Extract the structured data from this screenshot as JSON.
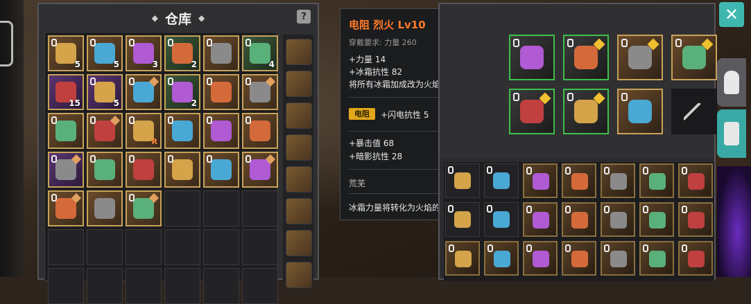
{
  "warehouse": {
    "title": "仓库",
    "help_label": "?",
    "slots": [
      [
        {
          "t": "gold",
          "c": "5",
          "lock": true
        },
        {
          "t": "gold",
          "c": "5",
          "lock": true
        },
        {
          "t": "gold",
          "c": "3",
          "lock": true
        },
        {
          "t": "green",
          "c": "2",
          "lock": true
        },
        {
          "t": "gold",
          "c": "",
          "lock": true
        },
        {
          "t": "green",
          "c": "4",
          "lock": true
        }
      ],
      [
        {
          "t": "purple",
          "c": "15",
          "lock": false
        },
        {
          "t": "purple",
          "c": "5",
          "lock": true
        },
        {
          "t": "gold",
          "c": "",
          "lock": true,
          "gem": true
        },
        {
          "t": "green",
          "c": "2",
          "lock": true
        },
        {
          "t": "gold",
          "c": "",
          "lock": true
        },
        {
          "t": "gold",
          "c": "",
          "lock": true,
          "gem": true
        }
      ],
      [
        {
          "t": "gold",
          "c": "",
          "lock": true
        },
        {
          "t": "gold",
          "c": "",
          "lock": true,
          "gem": true
        },
        {
          "t": "gold",
          "c": "",
          "lock": true,
          "r": "R"
        },
        {
          "t": "gold",
          "c": "",
          "lock": true
        },
        {
          "t": "gold",
          "c": "",
          "lock": true
        },
        {
          "t": "gold",
          "c": "",
          "lock": true
        }
      ],
      [
        {
          "t": "purple",
          "c": "",
          "lock": true,
          "gem": true
        },
        {
          "t": "gold",
          "c": "",
          "lock": true
        },
        {
          "t": "gold",
          "c": "",
          "lock": true
        },
        {
          "t": "gold",
          "c": "",
          "lock": true
        },
        {
          "t": "gold",
          "c": "",
          "lock": true
        },
        {
          "t": "gold",
          "c": "",
          "lock": true,
          "gem": true
        }
      ],
      [
        {
          "t": "gold",
          "c": "",
          "lock": true,
          "gem": true
        },
        {
          "t": "gold",
          "c": "",
          "lock": false
        },
        {
          "t": "gold",
          "c": "",
          "lock": true,
          "gem": true
        },
        {
          "t": "empty"
        },
        {
          "t": "empty"
        },
        {
          "t": "empty"
        }
      ],
      [
        {
          "t": "empty"
        },
        {
          "t": "empty"
        },
        {
          "t": "empty"
        },
        {
          "t": "empty"
        },
        {
          "t": "empty"
        },
        {
          "t": "empty"
        }
      ],
      [
        {
          "t": "empty"
        },
        {
          "t": "empty"
        },
        {
          "t": "empty"
        },
        {
          "t": "empty"
        },
        {
          "t": "empty"
        },
        {
          "t": "empty"
        }
      ]
    ],
    "side_items": 8
  },
  "tooltip": {
    "title": "电阻 烈火 Lv10",
    "requirement": "穿戴要求:   力量 260",
    "stats": [
      "+力量 14",
      "+冰霜抗性 82",
      "将所有冰霜加成改为火焰加成"
    ],
    "badge": "电阻",
    "badge_stat": "+闪电抗性 5",
    "extra_stats": [
      "+暴击值 68",
      "+暗影抗性 28"
    ],
    "set_name": "荒芜",
    "description": "冰霜力量将转化为火焰的力量"
  },
  "equipment": {
    "top_slots": [
      {
        "style": "green",
        "gem": false
      },
      {
        "style": "green",
        "gem": true
      },
      {
        "style": "gold",
        "gem": true
      },
      {
        "style": "gold",
        "gem": true
      },
      {
        "style": "green",
        "gem": true
      },
      {
        "style": "green",
        "gem": true
      },
      {
        "style": "gold",
        "gem": false
      },
      {
        "style": "dark",
        "gem": false
      }
    ],
    "inventory_rows": 3,
    "inventory_cols": 7
  },
  "colors": {
    "accent": "#3fb7b1",
    "gold_border": "#c8a35a",
    "green_border": "#3fbf4a",
    "title_orange": "#ff7a2a",
    "badge": "#e2a81a"
  },
  "icons": {
    "close": "close-icon",
    "helmet": "helmet-icon",
    "armor": "armor-icon",
    "help": "help-icon",
    "weapon_placeholder": "sword-icon"
  }
}
